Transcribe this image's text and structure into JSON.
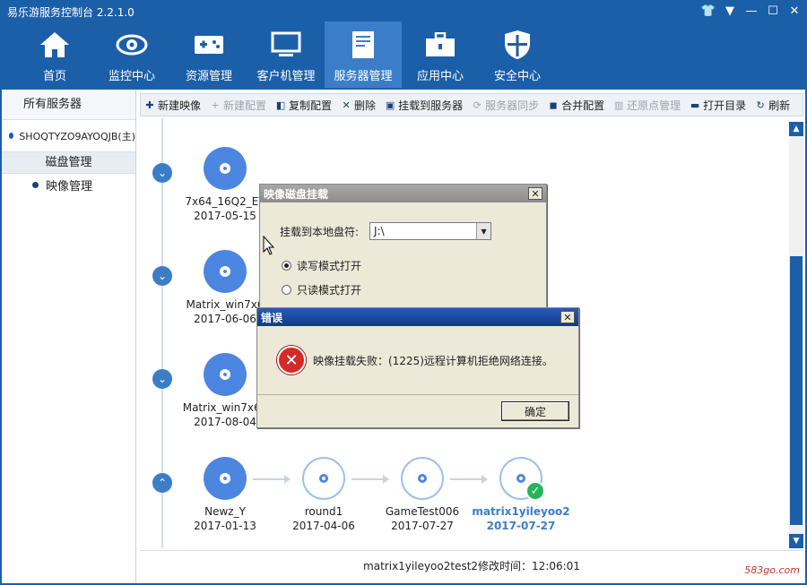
{
  "app": {
    "title": "易乐游服务控制台 2.2.1.0"
  },
  "window_controls": [
    {
      "name": "skin-icon",
      "glyph": "👕"
    },
    {
      "name": "menu-dropdown-icon",
      "glyph": "▼"
    },
    {
      "name": "minimize-icon",
      "glyph": "—"
    },
    {
      "name": "maximize-icon",
      "glyph": "☐"
    },
    {
      "name": "close-icon",
      "glyph": "✕"
    }
  ],
  "nav": [
    {
      "label": "首页",
      "icon": "home-icon"
    },
    {
      "label": "监控中心",
      "icon": "eye-icon"
    },
    {
      "label": "资源管理",
      "icon": "gamepad-icon"
    },
    {
      "label": "客户机管理",
      "icon": "monitor-icon"
    },
    {
      "label": "服务器管理",
      "icon": "server-icon",
      "active": true
    },
    {
      "label": "应用中心",
      "icon": "toolbox-icon"
    },
    {
      "label": "安全中心",
      "icon": "shield-icon"
    }
  ],
  "sidebar": {
    "header": "所有服务器",
    "server": "SHOQTYZO9AYOQJB(主)",
    "group": "磁盘管理",
    "sub_item": "映像管理"
  },
  "toolbar": [
    {
      "label": "新建映像",
      "icon": "new-image-icon",
      "glyph": "✚",
      "enabled": true
    },
    {
      "label": "新建配置",
      "icon": "new-config-icon",
      "glyph": "+",
      "enabled": false
    },
    {
      "label": "复制配置",
      "icon": "copy-icon",
      "glyph": "◧",
      "enabled": true
    },
    {
      "label": "删除",
      "icon": "delete-icon",
      "glyph": "✕",
      "enabled": true
    },
    {
      "label": "挂载到服务器",
      "icon": "mount-icon",
      "glyph": "▣",
      "enabled": true
    },
    {
      "label": "服务器同步",
      "icon": "sync-icon",
      "glyph": "⟳",
      "enabled": false
    },
    {
      "label": "合并配置",
      "icon": "merge-icon",
      "glyph": "◼",
      "enabled": true
    },
    {
      "label": "还原点管理",
      "icon": "restore-icon",
      "glyph": "▥",
      "enabled": false
    },
    {
      "label": "打开目录",
      "icon": "folder-icon",
      "glyph": "▬",
      "enabled": true
    },
    {
      "label": "刷新",
      "icon": "refresh-icon",
      "glyph": "↻",
      "enabled": true
    }
  ],
  "images": {
    "row1": {
      "name": "7x64_16Q2_EY",
      "date": "2017-05-15"
    },
    "row2": {
      "name": "Matrix_win7x6",
      "date": "2017-06-06"
    },
    "row3": {
      "name": "Matrix_win7x64",
      "date": "2017-08-04"
    },
    "row4": [
      {
        "name": "Newz_Y",
        "date": "2017-01-13"
      },
      {
        "name": "round1",
        "date": "2017-04-06"
      },
      {
        "name": "GameTest006",
        "date": "2017-07-27"
      },
      {
        "name": "matrix1yileyoo2",
        "date": "2017-07-27",
        "selected": true
      }
    ]
  },
  "status_text": "matrix1yileyoo2test2修改时间：12:06:01",
  "watermark": "583go.com",
  "mount_dialog": {
    "title": "映像磁盘挂载",
    "drive_label": "挂载到本地盘符:",
    "drive_value": "J:\\",
    "option_rw": "读写模式打开",
    "option_ro": "只读模式打开",
    "selected": "rw"
  },
  "error_dialog": {
    "title": "错误",
    "message": "映像挂载失败：(1225)远程计算机拒绝网络连接。",
    "ok_label": "确定"
  },
  "colors": {
    "brand": "#1c5fa9",
    "disc": "#4d86e0",
    "success": "#27b35a",
    "error": "#d42a2a"
  }
}
